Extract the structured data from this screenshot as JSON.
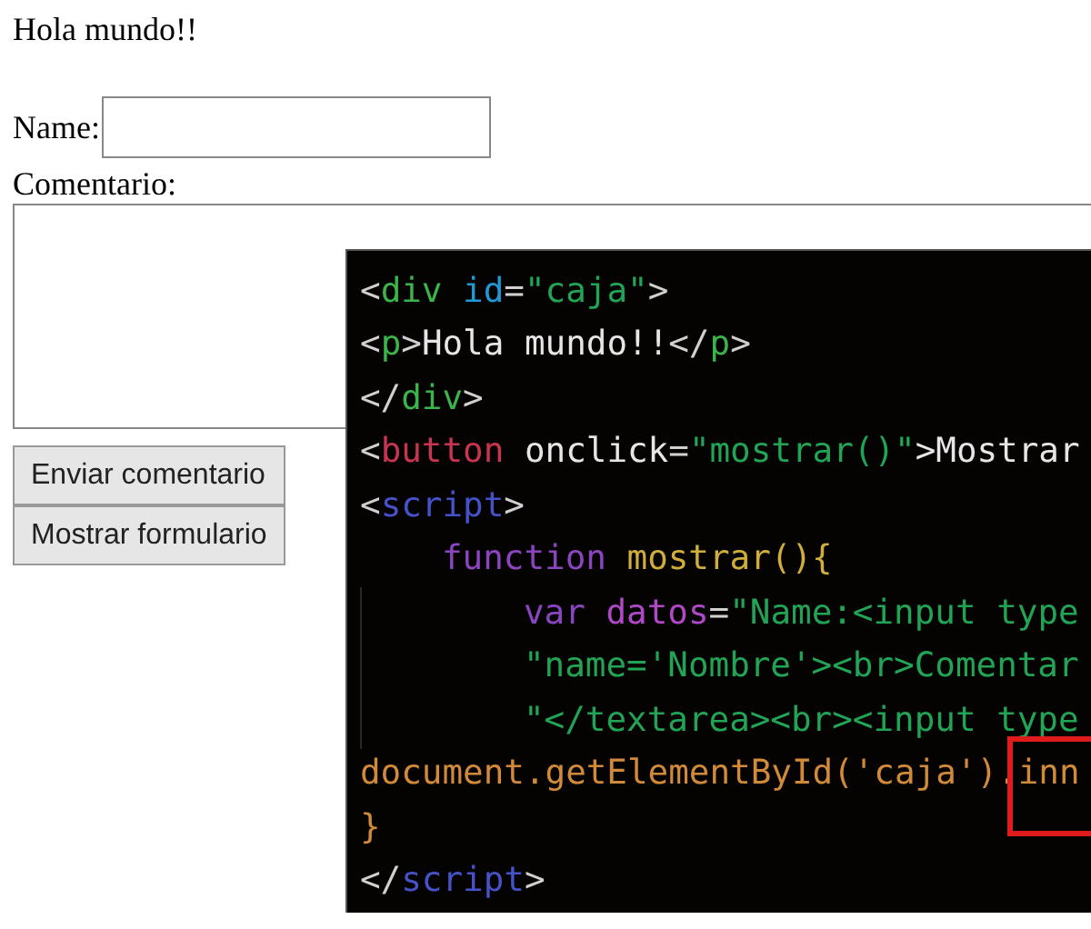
{
  "page": {
    "heading": "Hola mundo!!",
    "name_label": "Name:",
    "comment_label": "Comentario:",
    "buttons": [
      "Enviar comentario",
      "Mostrar formulario"
    ]
  },
  "code_panel": {
    "highlight": true,
    "lines": [
      [
        {
          "kind": "punct",
          "text": "<"
        },
        {
          "kind": "tag",
          "text": "div "
        },
        {
          "kind": "attr",
          "text": "id"
        },
        {
          "kind": "punct",
          "text": "="
        },
        {
          "kind": "string",
          "text": "\"caja\""
        },
        {
          "kind": "punct",
          "text": ">"
        }
      ],
      [
        {
          "kind": "punct",
          "text": "<"
        },
        {
          "kind": "tag",
          "text": "p"
        },
        {
          "kind": "punct",
          "text": ">"
        },
        {
          "kind": "text",
          "text": "Hola mundo!!"
        },
        {
          "kind": "punct",
          "text": "</"
        },
        {
          "kind": "tag",
          "text": "p"
        },
        {
          "kind": "punct",
          "text": ">"
        }
      ],
      [
        {
          "kind": "punct",
          "text": "</"
        },
        {
          "kind": "tag",
          "text": "div"
        },
        {
          "kind": "punct",
          "text": ">"
        }
      ],
      [
        {
          "kind": "punct",
          "text": "<"
        },
        {
          "kind": "element",
          "text": "button "
        },
        {
          "kind": "text",
          "text": "onclick"
        },
        {
          "kind": "punct",
          "text": "="
        },
        {
          "kind": "string",
          "text": "\"mostrar()\""
        },
        {
          "kind": "text",
          "text": ">Mostrar"
        }
      ],
      [
        {
          "kind": "punct",
          "text": "<"
        },
        {
          "kind": "script",
          "text": "script"
        },
        {
          "kind": "punct",
          "text": ">"
        }
      ],
      [
        {
          "kind": "indent1"
        },
        {
          "kind": "keyword",
          "text": "function "
        },
        {
          "kind": "func",
          "text": "mostrar(){"
        }
      ],
      [
        {
          "kind": "indent2"
        },
        {
          "kind": "keyword",
          "text": "var "
        },
        {
          "kind": "variable",
          "text": "datos"
        },
        {
          "kind": "punct",
          "text": "="
        },
        {
          "kind": "string",
          "text": "\"Name:<input type"
        }
      ],
      [
        {
          "kind": "indent2"
        },
        {
          "kind": "string",
          "text": "\"name='Nombre'><br>Comentar"
        }
      ],
      [
        {
          "kind": "indent2"
        },
        {
          "kind": "string",
          "text": "\"</textarea><br><input type"
        }
      ],
      [
        {
          "kind": "dom",
          "text": "document.getElementById('caja').inn"
        }
      ],
      [
        {
          "kind": "dom",
          "text": "}"
        }
      ],
      [
        {
          "kind": "punct",
          "text": "</"
        },
        {
          "kind": "script",
          "text": "script"
        },
        {
          "kind": "punct",
          "text": ">"
        }
      ]
    ]
  }
}
